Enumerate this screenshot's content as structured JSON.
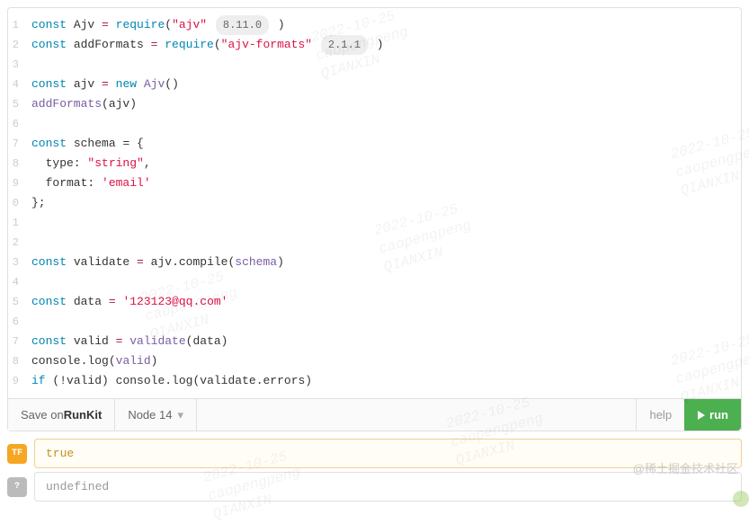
{
  "code": {
    "lines": [
      {
        "n": "1"
      },
      {
        "n": "2"
      },
      {
        "n": "3"
      },
      {
        "n": "4"
      },
      {
        "n": "5"
      },
      {
        "n": "6"
      },
      {
        "n": "7"
      },
      {
        "n": "8"
      },
      {
        "n": "9"
      },
      {
        "n": "0"
      },
      {
        "n": "1"
      },
      {
        "n": "2"
      },
      {
        "n": "3"
      },
      {
        "n": "4"
      },
      {
        "n": "5"
      },
      {
        "n": "6"
      },
      {
        "n": "7"
      },
      {
        "n": "8"
      },
      {
        "n": "9"
      }
    ],
    "tokens": {
      "const": "const",
      "Ajv": "Ajv",
      "eq": " = ",
      "require": "require",
      "lp": "(",
      "rp": ")",
      "ajv_pkg": "\"ajv\"",
      "ajv_ver": "8.11.0",
      "addFormats": "addFormats",
      "ajvf_pkg": "\"ajv-formats\"",
      "ajvf_ver": "2.1.1",
      "ajv": "ajv",
      "new": "new ",
      "AjvCtor": "Ajv",
      "empty": "()",
      "addFormatsCall": "addFormats",
      "ajvArg": "(ajv)",
      "schema": "schema",
      "brace_open": " = {",
      "type_key": "  type: ",
      "type_val": "\"string\"",
      "comma": ",",
      "format_key": "  format: ",
      "format_val": "'email'",
      "brace_close": "};",
      "validate": "validate",
      "compile": ".compile(",
      "schema_arg": "schema",
      "rp2": ")",
      "data": "data",
      "data_val": "'123123@qq.com'",
      "valid": "valid",
      "validateCall": "validate",
      "dataArg": "(data)",
      "console": "console",
      "log": ".log",
      "validArg": "(valid)",
      "if": "if ",
      "not": "(!",
      "validVar": "valid",
      "rp3": ") ",
      "logErrors": "console",
      "logM": ".log(",
      "validateV": "validate",
      "errors": ".errors",
      ")": ")"
    }
  },
  "toolbar": {
    "save_prefix": "Save on ",
    "save_bold": "RunKit",
    "node": "Node 14",
    "help": "help",
    "run": "run"
  },
  "output": {
    "badge1": "TF",
    "val1": "true",
    "badge2": "?",
    "val2": "undefined"
  },
  "watermarks": {
    "date": "2022-10-25",
    "user": "caopengpeng",
    "org": "QIANXIN"
  },
  "credit": "@稀土掘金技术社区"
}
